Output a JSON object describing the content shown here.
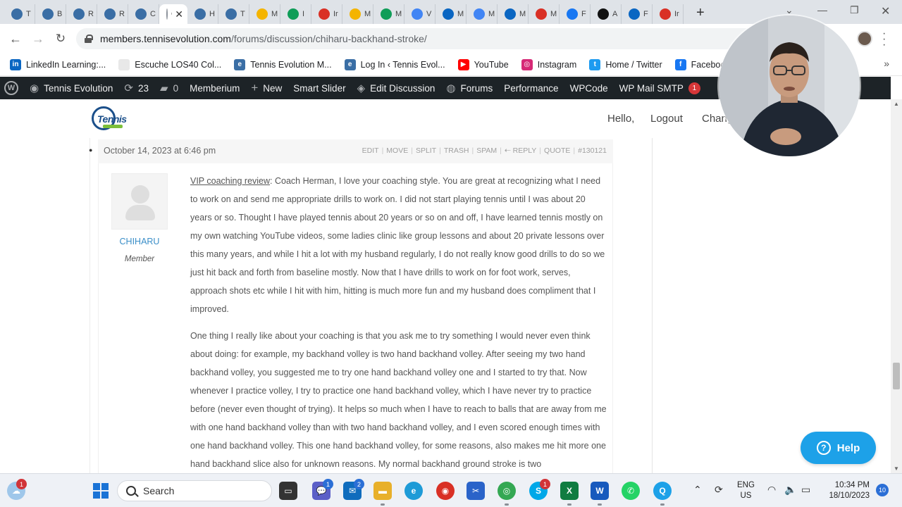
{
  "browser": {
    "tabs": [
      {
        "title": "T",
        "icon": "wp",
        "color": "#3a6ea5"
      },
      {
        "title": "B",
        "icon": "wp",
        "color": "#3a6ea5"
      },
      {
        "title": "R",
        "icon": "wp",
        "color": "#3a6ea5"
      },
      {
        "title": "R",
        "icon": "wp",
        "color": "#3a6ea5"
      },
      {
        "title": "C",
        "icon": "wp",
        "color": "#3a6ea5"
      },
      {
        "title": "C",
        "icon": "loading",
        "color": "#8a9099",
        "active": true
      },
      {
        "title": "H",
        "icon": "wp",
        "color": "#3a6ea5"
      },
      {
        "title": "T",
        "icon": "wp",
        "color": "#3a6ea5"
      },
      {
        "title": "M",
        "icon": "drive",
        "color": "#f4b400"
      },
      {
        "title": "I",
        "icon": "sheets",
        "color": "#0f9d58"
      },
      {
        "title": "Ir",
        "icon": "gmail",
        "color": "#d93025"
      },
      {
        "title": "M",
        "icon": "drive",
        "color": "#f4b400"
      },
      {
        "title": "M",
        "icon": "sheets",
        "color": "#0f9d58"
      },
      {
        "title": "V",
        "icon": "docs",
        "color": "#4285f4"
      },
      {
        "title": "M",
        "icon": "outlook",
        "color": "#0a66c2"
      },
      {
        "title": "M",
        "icon": "docs",
        "color": "#4285f4"
      },
      {
        "title": "M",
        "icon": "outlook",
        "color": "#0a66c2"
      },
      {
        "title": "M",
        "icon": "gmail",
        "color": "#d93025"
      },
      {
        "title": "F",
        "icon": "facebook",
        "color": "#1877f2"
      },
      {
        "title": "A",
        "icon": "x",
        "color": "#111111"
      },
      {
        "title": "F",
        "icon": "linkedin",
        "color": "#0a66c2"
      },
      {
        "title": "Ir",
        "icon": "gmail",
        "color": "#d93025"
      }
    ],
    "url_host": "members.tennisevolution.com",
    "url_path": "/forums/discussion/chiharu-backhand-stroke/",
    "bookmarks": [
      {
        "label": "LinkedIn Learning:...",
        "icon": "linkedin-icon",
        "color": "#0a66c2",
        "glyph": "in"
      },
      {
        "label": "Escuche LOS40 Col...",
        "icon": "los40-icon",
        "color": "#e8e8e8",
        "glyph": ""
      },
      {
        "label": "Tennis Evolution M...",
        "icon": "tennis-evolution-icon",
        "color": "#3a6ea5",
        "glyph": "e"
      },
      {
        "label": "Log In ‹ Tennis Evol...",
        "icon": "tennis-evolution-icon",
        "color": "#3a6ea5",
        "glyph": "e"
      },
      {
        "label": "YouTube",
        "icon": "youtube-icon",
        "color": "#ff0000",
        "glyph": "▶"
      },
      {
        "label": "Instagram",
        "icon": "instagram-icon",
        "color": "#d62976",
        "glyph": "◎"
      },
      {
        "label": "Home / Twitter",
        "icon": "twitter-icon",
        "color": "#1d9bf0",
        "glyph": "t"
      },
      {
        "label": "Facebook – log in",
        "icon": "facebook-icon",
        "color": "#1877f2",
        "glyph": "f"
      }
    ]
  },
  "adminbar": {
    "site_name": "Tennis Evolution",
    "updates": "23",
    "comments": "0",
    "items": [
      "Memberium",
      "New",
      "Smart Slider",
      "Edit Discussion",
      "Forums",
      "Performance",
      "WPCode",
      "WP Mail SMTP"
    ],
    "smtp_badge": "1"
  },
  "site": {
    "logo_text": "Tennis",
    "hello": "Hello,",
    "logout": "Logout",
    "change": "Chang"
  },
  "reply": {
    "date": "October 14, 2023 at 6:46 pm",
    "actions": [
      "EDIT",
      "MOVE",
      "SPLIT",
      "TRASH",
      "SPAM",
      "⇠ REPLY",
      "QUOTE",
      "#130121"
    ],
    "author": "CHIHARU",
    "role": "Member",
    "link_text": "VIP coaching review",
    "paragraph1": ": Coach Herman, I love your coaching style. You are great at recognizing what I need to work on and send me appropriate drills to work on. I did not start playing tennis until I was about 20 years or so. Thought I have played tennis about 20 years or so on and off, I have learned tennis mostly on my own watching YouTube videos, some ladies clinic like group lessons and about 20 private lessons over this many years, and while I hit a lot with my husband regularly, I do not really know good drills to do so we just hit back and forth from baseline mostly. Now that I have drills to work on for foot work, serves, approach shots etc while I hit with him, hitting is much more fun and my husband does compliment that I improved.",
    "paragraph2": "One thing I really like about your coaching is that you ask me to try something I would never even think about doing: for example, my backhand volley is two hand backhand volley. After seeing my two hand backhand volley, you suggested me to try one hand backhand volley one and I started to try that. Now whenever I practice volley, I try to practice one hand backhand volley, which I have never try to practice before (never even thought of trying). It helps so much when I have to reach to balls that are away from me with one hand backhand volley than with two hand backhand volley, and I even scored enough times with one hand backhand volley. This one hand backhand volley, for some reasons, also makes me hit more one hand backhand slice also for unknown reasons. My normal backhand ground stroke is two"
  },
  "help": {
    "label": "Help"
  },
  "taskbar": {
    "search_placeholder": "Search",
    "weather_badge": "1",
    "teams_badge": "1",
    "mail_badge": "2",
    "skype_badge": "1",
    "lang_line1": "ENG",
    "lang_line2": "US",
    "time": "10:34 PM",
    "date": "18/10/2023",
    "notifications": "10"
  }
}
